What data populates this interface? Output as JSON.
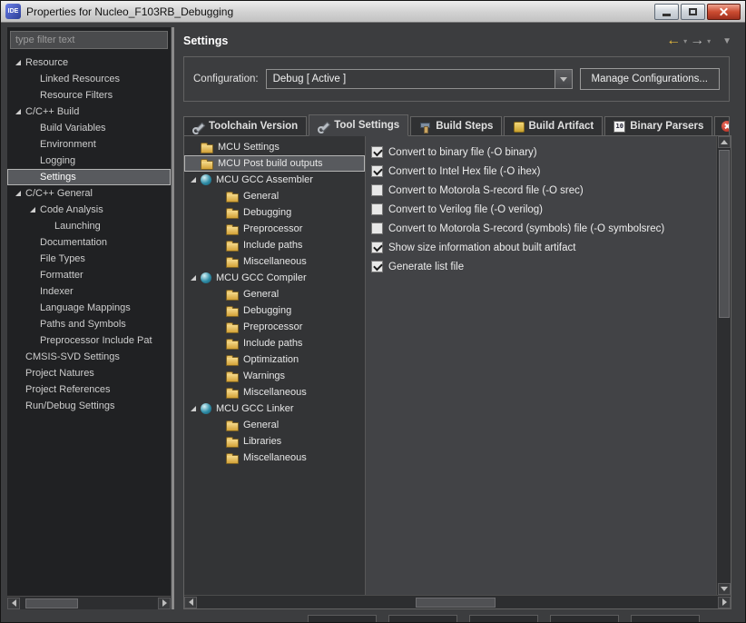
{
  "titlebar": {
    "icon_text": "IDE",
    "title": "Properties for Nucleo_F103RB_Debugging"
  },
  "sidebar": {
    "filter_placeholder": "type filter text",
    "tree": [
      {
        "label": "Resource",
        "indent": 0,
        "arrow": true
      },
      {
        "label": "Linked Resources",
        "indent": 1
      },
      {
        "label": "Resource Filters",
        "indent": 1
      },
      {
        "label": "C/C++ Build",
        "indent": 0,
        "arrow": true
      },
      {
        "label": "Build Variables",
        "indent": 1
      },
      {
        "label": "Environment",
        "indent": 1
      },
      {
        "label": "Logging",
        "indent": 1
      },
      {
        "label": "Settings",
        "indent": 1,
        "selected": true
      },
      {
        "label": "C/C++ General",
        "indent": 0,
        "arrow": true
      },
      {
        "label": "Code Analysis",
        "indent": 1,
        "arrow": true
      },
      {
        "label": "Launching",
        "indent": 2
      },
      {
        "label": "Documentation",
        "indent": 1
      },
      {
        "label": "File Types",
        "indent": 1
      },
      {
        "label": "Formatter",
        "indent": 1
      },
      {
        "label": "Indexer",
        "indent": 1
      },
      {
        "label": "Language Mappings",
        "indent": 1
      },
      {
        "label": "Paths and Symbols",
        "indent": 1
      },
      {
        "label": "Preprocessor Include Pat",
        "indent": 1
      },
      {
        "label": "CMSIS-SVD Settings",
        "indent": 0
      },
      {
        "label": "Project Natures",
        "indent": 0
      },
      {
        "label": "Project References",
        "indent": 0
      },
      {
        "label": "Run/Debug Settings",
        "indent": 0
      }
    ]
  },
  "header": {
    "title": "Settings"
  },
  "config": {
    "label": "Configuration:",
    "value": "Debug  [ Active ]",
    "manage_button": "Manage Configurations..."
  },
  "tabs": [
    {
      "label": "Toolchain Version",
      "icon": "wrench"
    },
    {
      "label": "Tool Settings",
      "icon": "wrench",
      "active": true
    },
    {
      "label": "Build Steps",
      "icon": "hammer"
    },
    {
      "label": "Build Artifact",
      "icon": "artifact"
    },
    {
      "label": "Binary Parsers",
      "icon": "binary"
    },
    {
      "label": "",
      "icon": "error",
      "partial": true
    }
  ],
  "tool_settings": {
    "tree": [
      {
        "label": "MCU Settings",
        "indent": 0,
        "icon": "folder"
      },
      {
        "label": "MCU Post build outputs",
        "indent": 0,
        "icon": "folder",
        "selected": true
      },
      {
        "label": "MCU GCC Assembler",
        "indent": 0,
        "icon": "tool",
        "arrow": true
      },
      {
        "label": "General",
        "indent": 1,
        "icon": "folder"
      },
      {
        "label": "Debugging",
        "indent": 1,
        "icon": "folder"
      },
      {
        "label": "Preprocessor",
        "indent": 1,
        "icon": "folder"
      },
      {
        "label": "Include paths",
        "indent": 1,
        "icon": "folder"
      },
      {
        "label": "Miscellaneous",
        "indent": 1,
        "icon": "folder"
      },
      {
        "label": "MCU GCC Compiler",
        "indent": 0,
        "icon": "tool",
        "arrow": true
      },
      {
        "label": "General",
        "indent": 1,
        "icon": "folder"
      },
      {
        "label": "Debugging",
        "indent": 1,
        "icon": "folder"
      },
      {
        "label": "Preprocessor",
        "indent": 1,
        "icon": "folder"
      },
      {
        "label": "Include paths",
        "indent": 1,
        "icon": "folder"
      },
      {
        "label": "Optimization",
        "indent": 1,
        "icon": "folder"
      },
      {
        "label": "Warnings",
        "indent": 1,
        "icon": "folder"
      },
      {
        "label": "Miscellaneous",
        "indent": 1,
        "icon": "folder"
      },
      {
        "label": "MCU GCC Linker",
        "indent": 0,
        "icon": "tool",
        "arrow": true
      },
      {
        "label": "General",
        "indent": 1,
        "icon": "folder"
      },
      {
        "label": "Libraries",
        "indent": 1,
        "icon": "folder"
      },
      {
        "label": "Miscellaneous",
        "indent": 1,
        "icon": "folder"
      }
    ],
    "options": [
      {
        "label": "Convert to binary file (-O binary)",
        "checked": true
      },
      {
        "label": "Convert to Intel Hex file (-O ihex)",
        "checked": true
      },
      {
        "label": "Convert to Motorola S-record file (-O srec)",
        "checked": false
      },
      {
        "label": "Convert to Verilog file (-O verilog)",
        "checked": false
      },
      {
        "label": "Convert to Motorola S-record (symbols) file (-O symbolsrec)",
        "checked": false
      },
      {
        "label": "Show size information about built artifact",
        "checked": true
      },
      {
        "label": "Generate list file",
        "checked": true
      }
    ]
  }
}
